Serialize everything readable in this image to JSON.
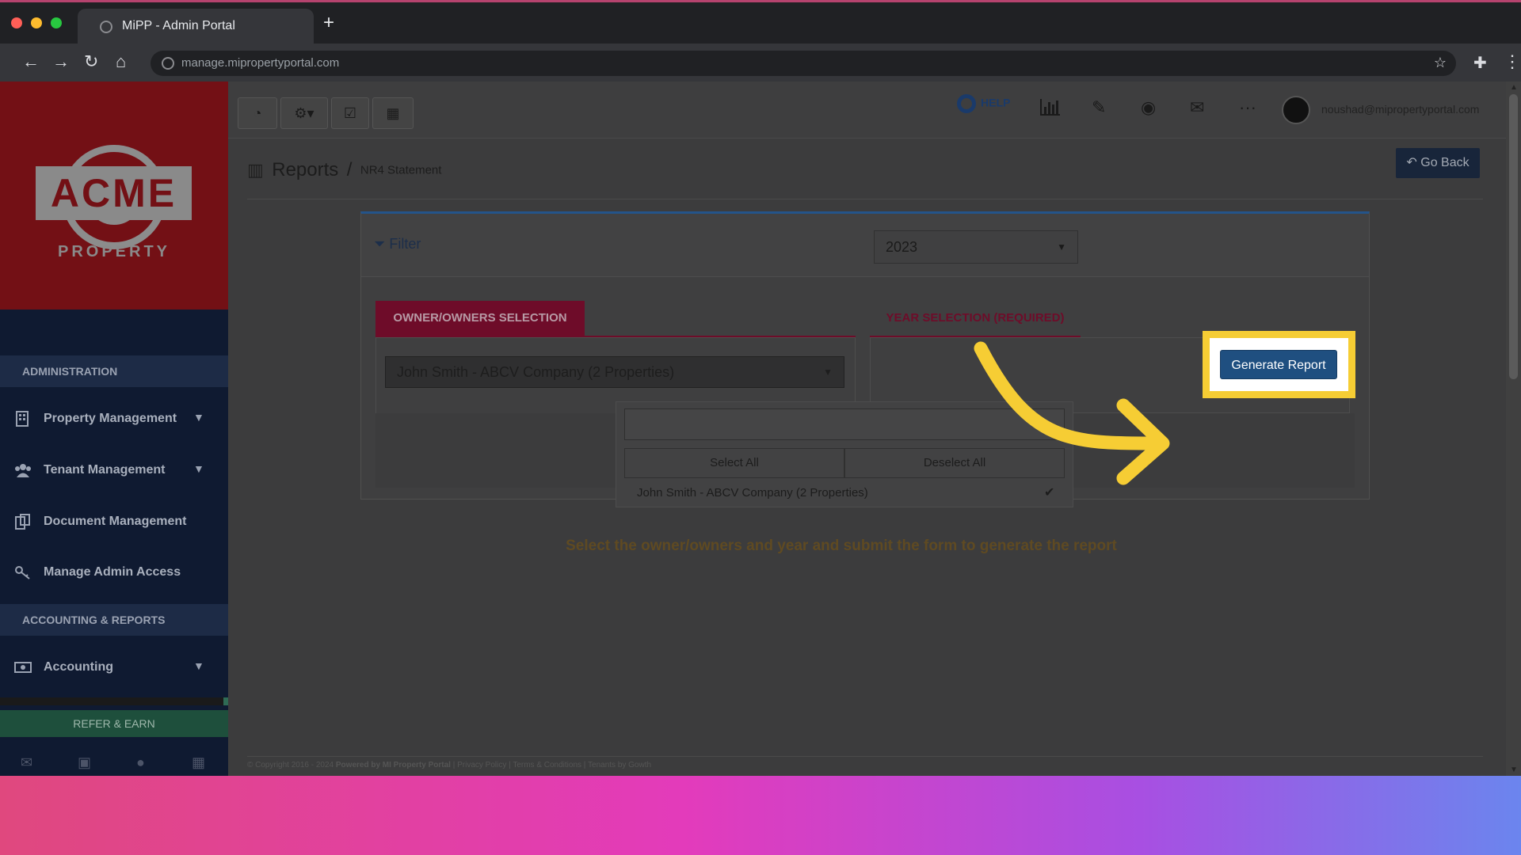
{
  "browser": {
    "tab_title": "MiPP - Admin Portal",
    "url": "manage.mipropertyportal.com"
  },
  "logo": {
    "wordmark": "ACME",
    "subtitle": "PROPERTY"
  },
  "sidebar": {
    "section_admin": "ADMINISTRATION",
    "section_accounting": "ACCOUNTING & REPORTS",
    "items": [
      {
        "label": "Property Management",
        "icon": "building-icon",
        "expandable": true
      },
      {
        "label": "Tenant Management",
        "icon": "users-icon",
        "expandable": true
      },
      {
        "label": "Document Management",
        "icon": "documents-icon",
        "expandable": false
      },
      {
        "label": "Manage Admin Access",
        "icon": "key-icon",
        "expandable": false
      },
      {
        "label": "Accounting",
        "icon": "money-icon",
        "expandable": true
      }
    ],
    "refer_button": "REFER & EARN"
  },
  "topbar": {
    "help_label": "HELP",
    "user_email": "noushad@mipropertyportal.com"
  },
  "breadcrumb": {
    "title": "Reports",
    "separator": "/",
    "current": "NR4 Statement"
  },
  "go_back_label": "Go Back",
  "filter": {
    "title": "Filter",
    "owner_tab": "OWNER/OWNERS SELECTION",
    "year_tab": "YEAR SELECTION (REQUIRED)",
    "owner_selected": "John Smith - ABCV Company (2 Properties)",
    "year_selected": "2023",
    "select_all": "Select All",
    "deselect_all": "Deselect All",
    "options": [
      {
        "label": "John Smith - ABCV Company (2 Properties)",
        "checked": true
      }
    ],
    "search_value": ""
  },
  "generate_button": "Generate Report",
  "hint": "Select the owner/owners and year and submit the form to generate the report",
  "footer": {
    "copyright": "© Copyright 2016 - 2024",
    "powered": "Powered by MI Property Portal",
    "privacy": "Privacy Policy",
    "terms": "Terms & Conditions",
    "extra": "Tenants by Gowth"
  },
  "colors": {
    "highlight": "#f6cd34",
    "primary_button": "#1f4f80",
    "accent_red": "#6e0c29"
  }
}
